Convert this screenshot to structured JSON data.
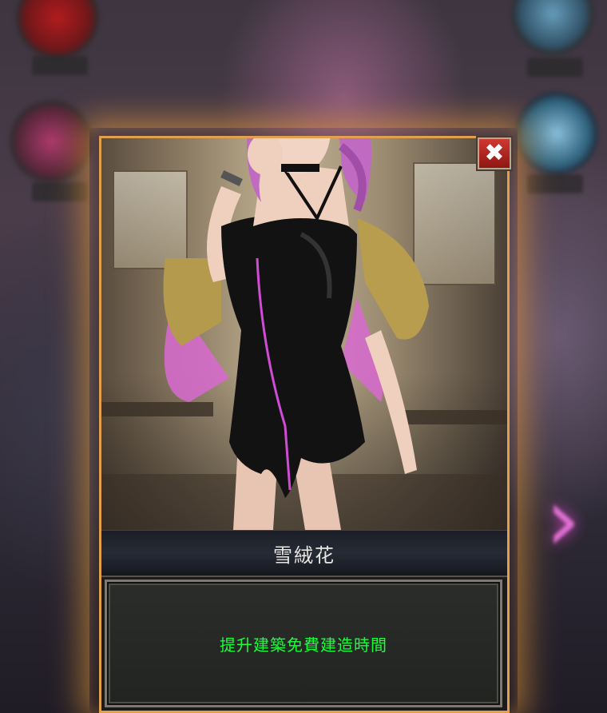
{
  "hero": {
    "name": "雪絨花",
    "description": "提升建築免費建造時間"
  },
  "icons": {
    "close": "close-icon",
    "next": "chevron-right-icon"
  },
  "colors": {
    "card_border": "#e2a04c",
    "glow": "#ffaa3c",
    "description_text": "#18ff3a",
    "close_button": "#c0282a",
    "next_arrow": "#ff7cf0"
  }
}
